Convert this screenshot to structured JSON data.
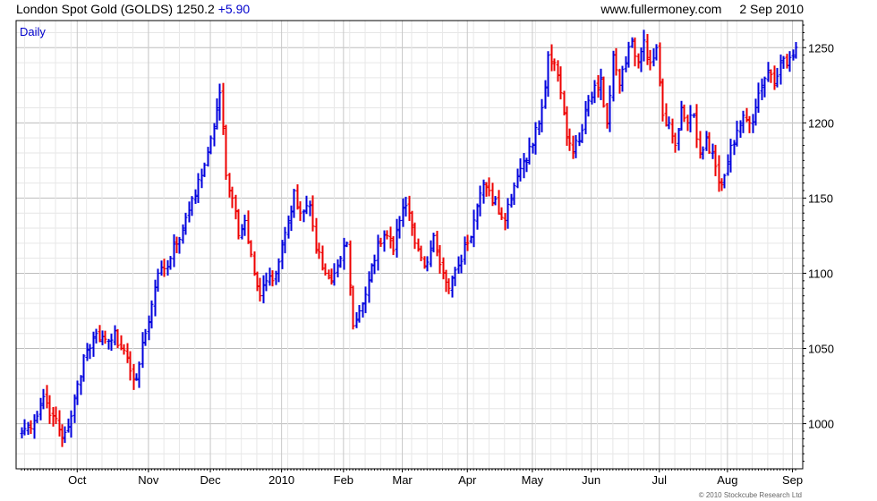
{
  "header": {
    "instrument": "London Spot Gold (GOLDS)",
    "last": "1250.2",
    "change": "+5.90",
    "site": "www.fullermoney.com",
    "date": "2 Sep 2010"
  },
  "credit": "© 2010 Stockcube Research Ltd",
  "colors": {
    "up": "#0000dd",
    "down": "#ee0000",
    "grid": "#d0d0d0",
    "change": "#0000cc"
  },
  "chart_data": {
    "type": "ohlc",
    "period_label": "Daily",
    "y_axis_side": "right",
    "ylim": [
      970,
      1268
    ],
    "y_ticks": [
      1000,
      1050,
      1100,
      1150,
      1200,
      1250
    ],
    "x_tick_labels": [
      "Oct",
      "Nov",
      "Dec",
      "2010",
      "Feb",
      "Mar",
      "Apr",
      "May",
      "Jun",
      "Jul",
      "Aug",
      "Sep"
    ],
    "x_tick_index": [
      18,
      41,
      61,
      84,
      104,
      123,
      144,
      165,
      184,
      206,
      228,
      249
    ],
    "grid": true,
    "close_anchors": [
      [
        0,
        995
      ],
      [
        4,
        1002
      ],
      [
        7,
        1018
      ],
      [
        10,
        1005
      ],
      [
        13,
        990
      ],
      [
        16,
        1005
      ],
      [
        20,
        1045
      ],
      [
        24,
        1060
      ],
      [
        28,
        1055
      ],
      [
        30,
        1062
      ],
      [
        32,
        1050
      ],
      [
        35,
        1035
      ],
      [
        37,
        1030
      ],
      [
        40,
        1060
      ],
      [
        44,
        1100
      ],
      [
        48,
        1110
      ],
      [
        52,
        1130
      ],
      [
        55,
        1150
      ],
      [
        58,
        1165
      ],
      [
        61,
        1190
      ],
      [
        63,
        1210
      ],
      [
        64,
        1220
      ],
      [
        66,
        1165
      ],
      [
        68,
        1150
      ],
      [
        70,
        1125
      ],
      [
        72,
        1135
      ],
      [
        75,
        1100
      ],
      [
        77,
        1085
      ],
      [
        79,
        1095
      ],
      [
        82,
        1100
      ],
      [
        84,
        1120
      ],
      [
        86,
        1135
      ],
      [
        88,
        1155
      ],
      [
        90,
        1140
      ],
      [
        93,
        1145
      ],
      [
        95,
        1115
      ],
      [
        98,
        1100
      ],
      [
        100,
        1095
      ],
      [
        103,
        1110
      ],
      [
        105,
        1120
      ],
      [
        107,
        1065
      ],
      [
        109,
        1075
      ],
      [
        112,
        1095
      ],
      [
        115,
        1120
      ],
      [
        118,
        1125
      ],
      [
        120,
        1115
      ],
      [
        122,
        1135
      ],
      [
        124,
        1145
      ],
      [
        127,
        1120
      ],
      [
        130,
        1105
      ],
      [
        133,
        1125
      ],
      [
        136,
        1100
      ],
      [
        138,
        1090
      ],
      [
        141,
        1105
      ],
      [
        144,
        1120
      ],
      [
        147,
        1145
      ],
      [
        149,
        1160
      ],
      [
        151,
        1155
      ],
      [
        154,
        1140
      ],
      [
        156,
        1135
      ],
      [
        158,
        1150
      ],
      [
        160,
        1165
      ],
      [
        162,
        1175
      ],
      [
        165,
        1185
      ],
      [
        168,
        1210
      ],
      [
        170,
        1245
      ],
      [
        172,
        1240
      ],
      [
        174,
        1220
      ],
      [
        176,
        1190
      ],
      [
        178,
        1180
      ],
      [
        181,
        1195
      ],
      [
        183,
        1215
      ],
      [
        185,
        1225
      ],
      [
        187,
        1230
      ],
      [
        189,
        1200
      ],
      [
        191,
        1245
      ],
      [
        193,
        1225
      ],
      [
        195,
        1240
      ],
      [
        197,
        1255
      ],
      [
        199,
        1240
      ],
      [
        201,
        1255
      ],
      [
        203,
        1240
      ],
      [
        205,
        1250
      ],
      [
        207,
        1205
      ],
      [
        209,
        1200
      ],
      [
        211,
        1185
      ],
      [
        213,
        1210
      ],
      [
        215,
        1200
      ],
      [
        217,
        1205
      ],
      [
        219,
        1180
      ],
      [
        221,
        1190
      ],
      [
        223,
        1180
      ],
      [
        225,
        1160
      ],
      [
        227,
        1165
      ],
      [
        229,
        1185
      ],
      [
        231,
        1195
      ],
      [
        233,
        1205
      ],
      [
        235,
        1200
      ],
      [
        237,
        1210
      ],
      [
        239,
        1225
      ],
      [
        241,
        1235
      ],
      [
        243,
        1225
      ],
      [
        245,
        1240
      ],
      [
        247,
        1238
      ],
      [
        249,
        1245
      ],
      [
        250,
        1250.2
      ]
    ]
  }
}
